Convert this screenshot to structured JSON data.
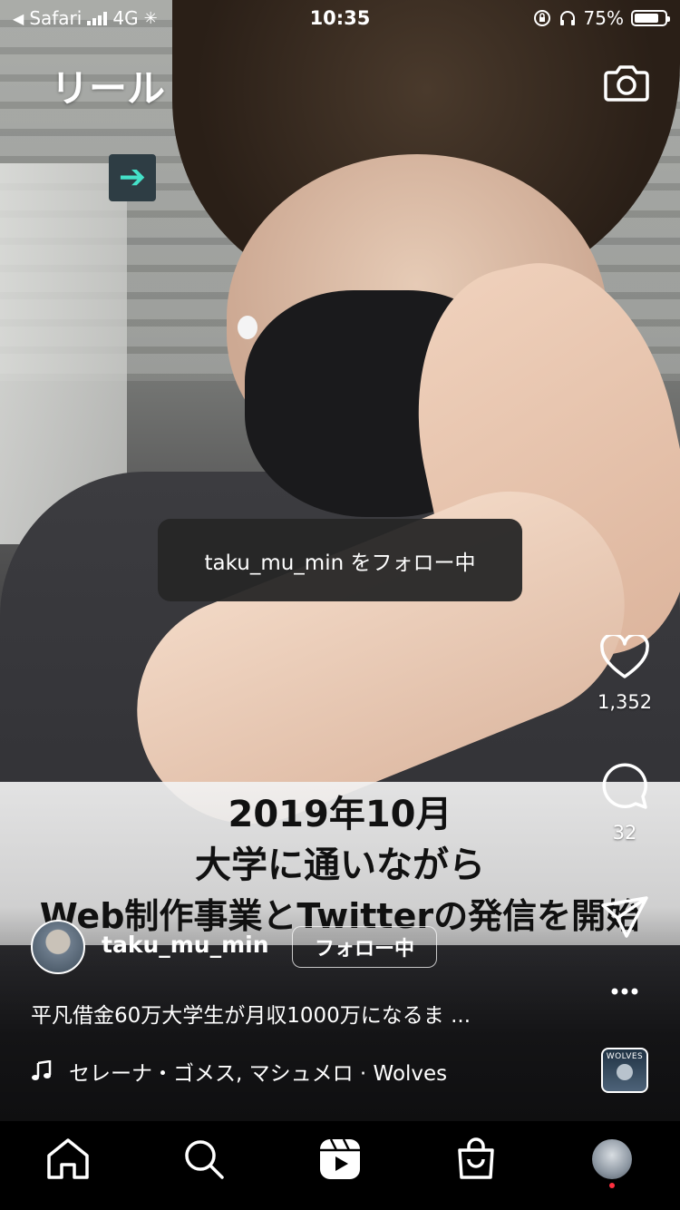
{
  "status_bar": {
    "back_app": "Safari",
    "network": "4G",
    "time": "10:35",
    "battery": "75%"
  },
  "header": {
    "title": "リール",
    "camera_icon": "camera-icon"
  },
  "video": {
    "caption_lines": [
      "2019年10月",
      "大学に通いながら",
      "Web制作事業とTwitterの発信を開始"
    ]
  },
  "toast": {
    "text": "taku_mu_min をフォロー中"
  },
  "actions": {
    "like_count": "1,352",
    "comment_count": "32",
    "icons": [
      "heart-icon",
      "comment-icon",
      "share-icon",
      "more-icon"
    ]
  },
  "post": {
    "username": "taku_mu_min",
    "follow_label": "フォロー中",
    "description": "平凡借金60万大学生が月収1000万になるま ...",
    "music": "セレーナ・ゴメス, マシュメロ · Wolves",
    "album_label": "WOLVES"
  },
  "nav": {
    "items": [
      "home-icon",
      "search-icon",
      "reels-icon",
      "shop-icon",
      "profile-avatar"
    ],
    "notification_color": "#ff3040"
  }
}
